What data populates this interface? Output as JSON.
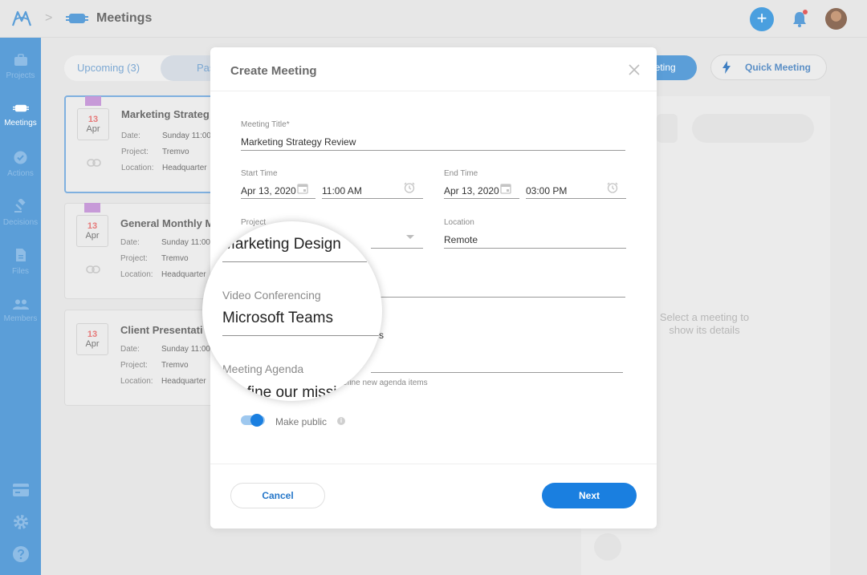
{
  "topbar": {
    "section_title": "Meetings",
    "breadcrumb_separator": ">",
    "add_label": "+"
  },
  "sidebar": {
    "items": [
      {
        "label": "Projects",
        "icon": "briefcase-icon",
        "active": false
      },
      {
        "label": "Meetings",
        "icon": "meetings-icon",
        "active": true
      },
      {
        "label": "Actions",
        "icon": "check-circle-icon",
        "active": false
      },
      {
        "label": "Decisions",
        "icon": "gavel-icon",
        "active": false
      },
      {
        "label": "Files",
        "icon": "file-icon",
        "active": false
      },
      {
        "label": "Members",
        "icon": "members-icon",
        "active": false
      }
    ],
    "bottom_icons": [
      "billing-icon",
      "gear-icon",
      "help-icon"
    ]
  },
  "list": {
    "tabs": [
      {
        "label": "Upcoming (3)"
      },
      {
        "label": "Pas"
      }
    ],
    "meetings": [
      {
        "day": "13",
        "month": "Apr",
        "title": "Marketing Strateg",
        "date_label": "Date:",
        "date": "Sunday 11:00",
        "project_label": "Project:",
        "project": "Tremvo",
        "location_label": "Location:",
        "location": "Headquarter",
        "flag": true,
        "link": true
      },
      {
        "day": "13",
        "month": "Apr",
        "title": "General Monthly M",
        "date_label": "Date:",
        "date": "Sunday 11:00",
        "project_label": "Project:",
        "project": "Tremvo",
        "location_label": "Location:",
        "location": "Headquarter",
        "flag": true,
        "link": true
      },
      {
        "day": "13",
        "month": "Apr",
        "title": "Client Presentati",
        "date_label": "Date:",
        "date": "Sunday 11:00",
        "project_label": "Project:",
        "project": "Tremvo",
        "location_label": "Location:",
        "location": "Headquarter",
        "flag": false,
        "link": false
      }
    ]
  },
  "actions": {
    "new_meeting_partial": "eeting",
    "quick_meeting": "Quick Meeting"
  },
  "detail": {
    "empty_message": "Select a meeting to show its details"
  },
  "modal": {
    "title": "Create Meeting",
    "fields": {
      "meeting_title": {
        "label": "Meeting Title*",
        "value": "Marketing Strategy Review"
      },
      "start_time": {
        "label": "Start Time",
        "date": "Apr 13, 2020",
        "time": "11:00 AM"
      },
      "end_time": {
        "label": "End Time",
        "date": "Apr 13, 2020",
        "time": "03:00 PM"
      },
      "project": {
        "label": "Project",
        "value": "Marketing Design"
      },
      "location": {
        "label": "Location",
        "value": "Remote"
      },
      "video_conferencing": {
        "label": "Video Conferencing",
        "value": "Microsoft Teams"
      },
      "meeting_agenda": {
        "label": "Meeting Agenda",
        "value_partial": "efine our missi",
        "hint_partial": "efine new agenda items"
      }
    },
    "partial_s": "s",
    "make_public": {
      "label": "Make public",
      "checked": true,
      "info": "i"
    },
    "cancel_label": "Cancel",
    "next_label": "Next"
  },
  "colors": {
    "sidebar": "#5b9ed8",
    "primary": "#1a7fe0",
    "date_red": "#e67a7a",
    "flag": "#c79ad8"
  }
}
